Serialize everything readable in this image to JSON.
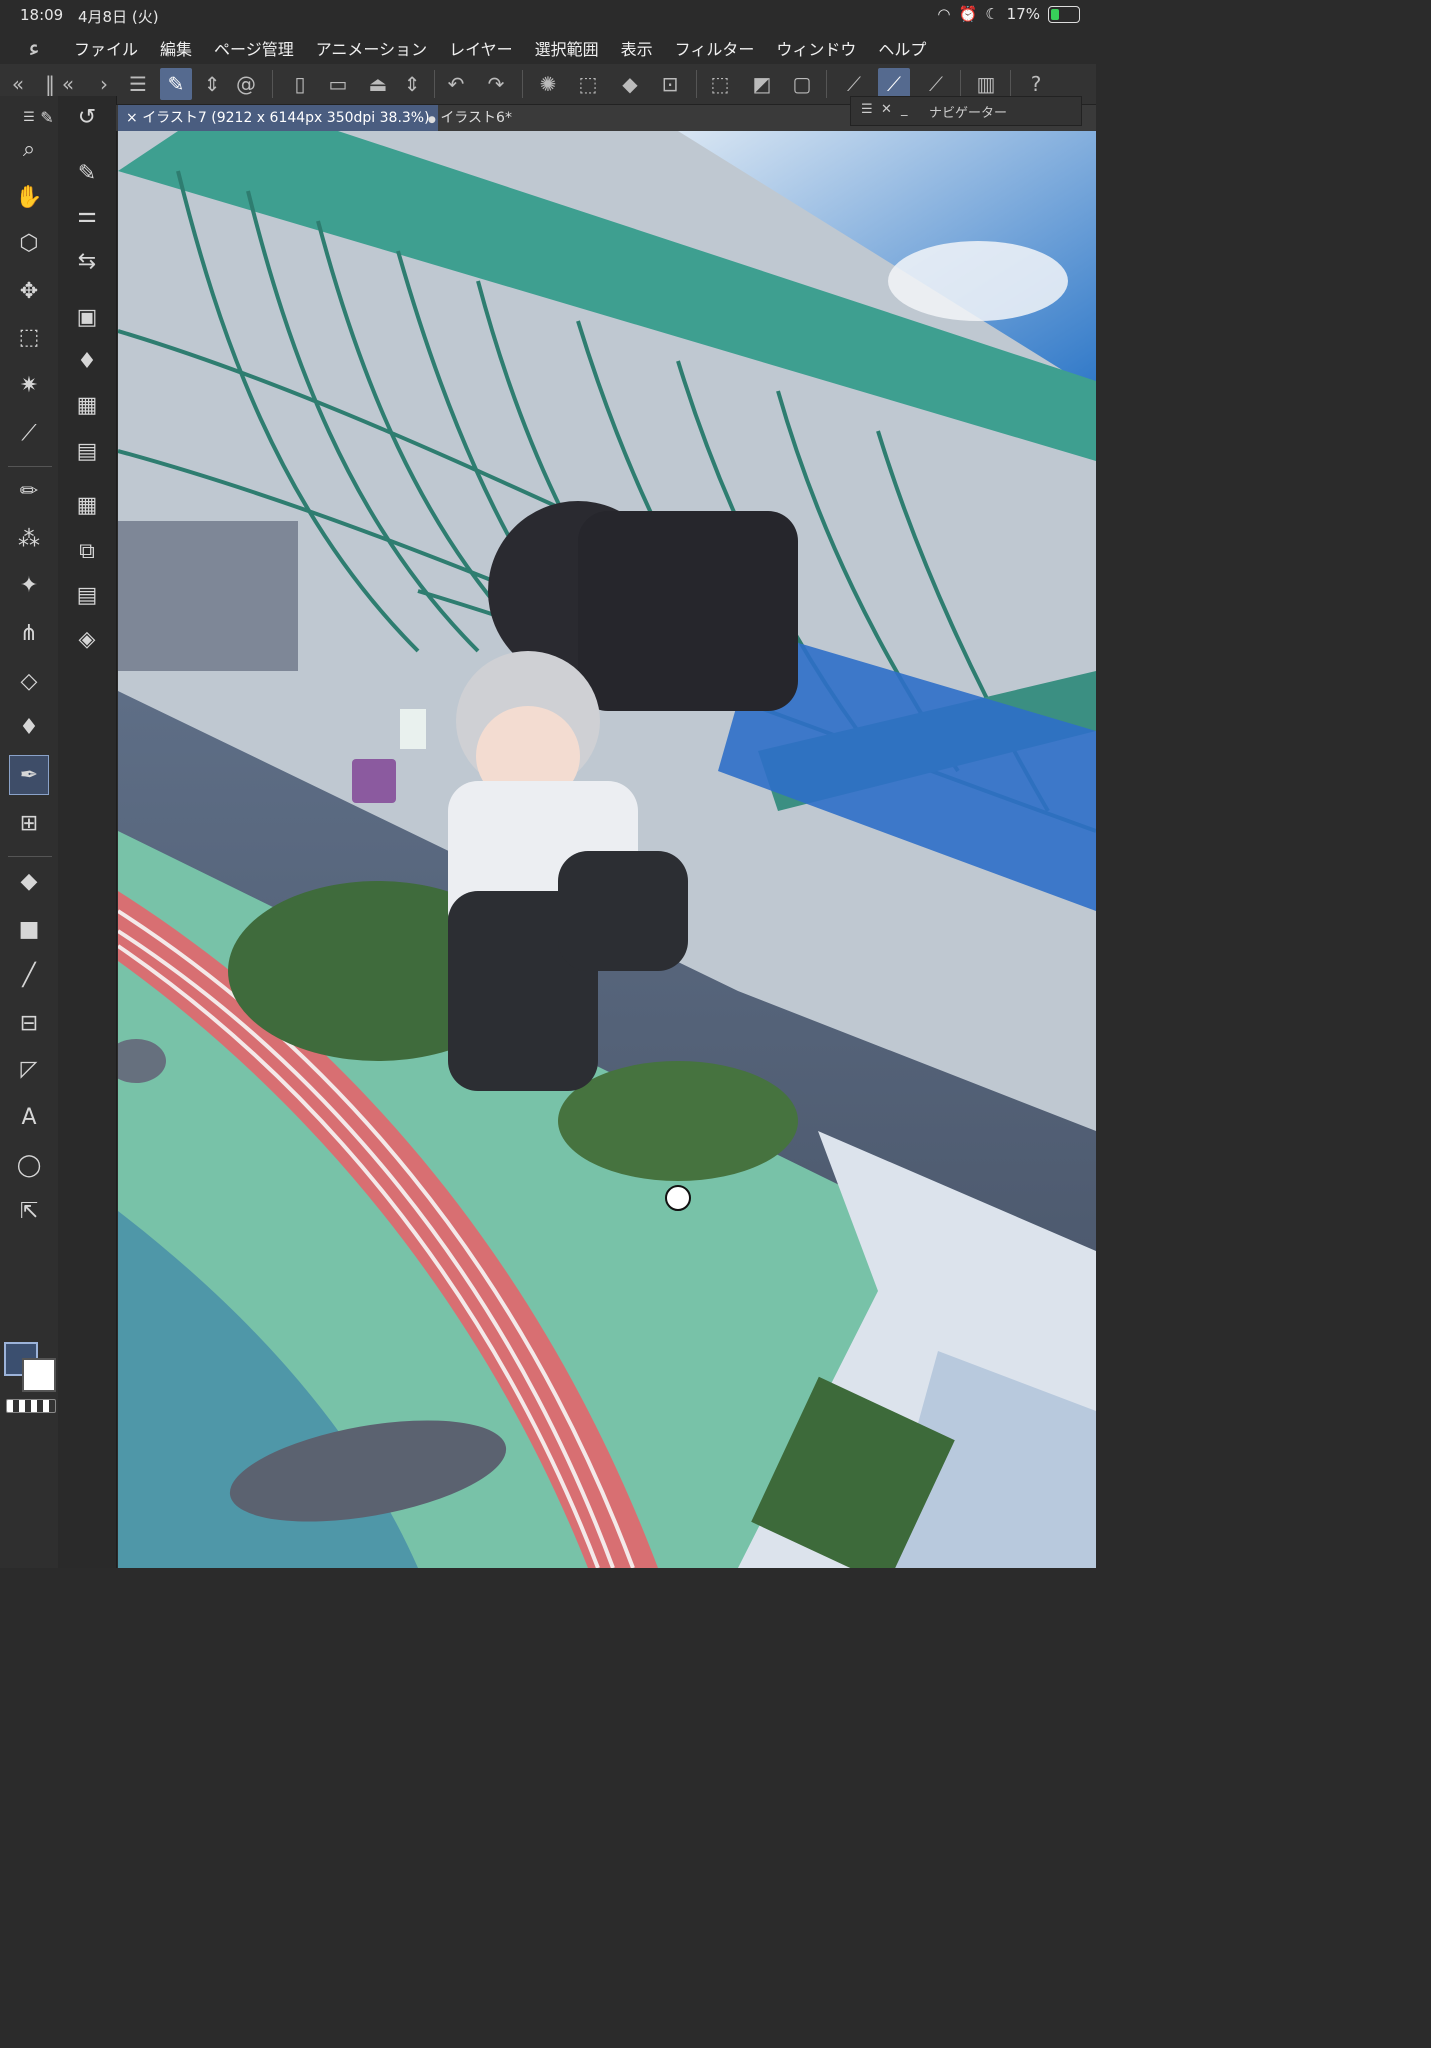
{
  "status_bar": {
    "time": "18:09",
    "date": "4月8日 (火)",
    "battery": "17%"
  },
  "menu": [
    "ファイル",
    "編集",
    "ページ管理",
    "アニメーション",
    "レイヤー",
    "選択範囲",
    "表示",
    "フィルター",
    "ウィンドウ",
    "ヘルプ"
  ],
  "tabs": [
    {
      "label": "イラスト7 (9212 x 6144px 350dpi 38.3%)",
      "active": true,
      "close": "×"
    },
    {
      "label": "イラスト6*",
      "active": false,
      "dot": "●"
    }
  ],
  "navigator": {
    "title": "ナビゲーター"
  },
  "colors": {
    "main": "#3b4f6f",
    "sub": "#ffffff",
    "accent": "#4a5d80"
  },
  "icons": {
    "left_strip": [
      "magnifier-icon",
      "hand-icon",
      "rotate-view-icon",
      "move-icon",
      "select-rect-icon",
      "auto-select-icon",
      "eyedropper-icon",
      "pen-icon",
      "spray-icon",
      "sparkle-icon",
      "grass-icon",
      "eraser-icon",
      "blend-icon",
      "vector-pen-icon",
      "mesh-icon",
      "fill-icon",
      "gradient-icon",
      "line-icon",
      "frame-icon",
      "ruler-icon",
      "text-icon",
      "balloon-icon",
      "correct-icon"
    ],
    "right_strip": [
      "undo-circle-icon",
      "brush-settings-icon",
      "sliders-icon",
      "transform-icon",
      "layer-property-icon",
      "fill-drop-icon",
      "material-icon",
      "film-icon",
      "timeline-icon",
      "layer-search-icon",
      "panel-icon",
      "layers-icon"
    ]
  }
}
